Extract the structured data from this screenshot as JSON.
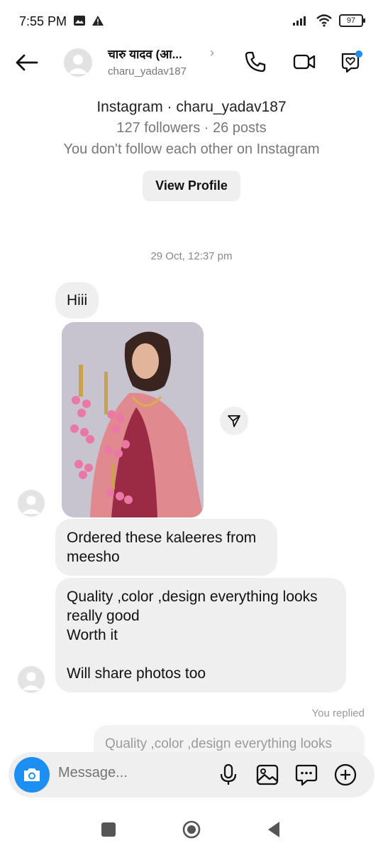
{
  "status_bar": {
    "time": "7:55 PM",
    "battery": "97"
  },
  "header": {
    "name": "चारु यादव (आ...",
    "username": "charu_yadav187"
  },
  "profile": {
    "platform_line": "Instagram · charu_yadav187",
    "stats": "127 followers · 26 posts",
    "follow_status": "You don't follow each other on Instagram",
    "view_profile_label": "View Profile"
  },
  "thread": {
    "timestamp": "29 Oct, 12:37 pm",
    "messages": [
      {
        "text": "Hiii"
      },
      {
        "text": "Ordered these kaleeres from meesho"
      },
      {
        "text": "Quality ,color ,design  everything looks really good\nWorth it\n\nWill share photos  too"
      }
    ],
    "replied_label": "You replied",
    "reply_preview": "Quality ,color ,design  everything looks"
  },
  "composer": {
    "placeholder": "Message..."
  },
  "icons": {
    "back": "back-arrow-icon",
    "phone": "phone-icon",
    "video": "video-camera-icon",
    "theme": "heart-chat-icon",
    "share": "paper-plane-icon",
    "camera": "camera-icon",
    "mic": "microphone-icon",
    "gallery": "gallery-icon",
    "sticker": "sticker-chat-icon",
    "more": "plus-circle-icon"
  },
  "colors": {
    "accent": "#1d8ff2",
    "bubble": "#efefef",
    "muted": "#777777"
  }
}
